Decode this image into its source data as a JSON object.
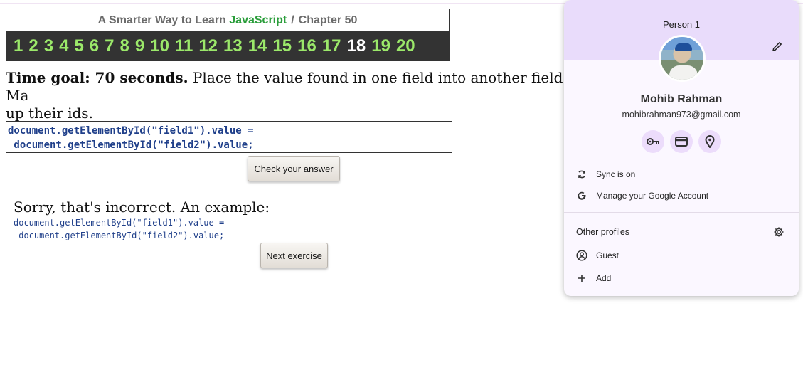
{
  "header": {
    "title_prefix": "A Smarter Way to Learn",
    "title_brand": "JavaScript",
    "separator": "/",
    "chapter": "Chapter 50"
  },
  "exercises": [
    "1",
    "2",
    "3",
    "4",
    "5",
    "6",
    "7",
    "8",
    "9",
    "10",
    "11",
    "12",
    "13",
    "14",
    "15",
    "16",
    "17",
    "18",
    "19",
    "20"
  ],
  "current_exercise": "18",
  "task": {
    "goal": "Time goal: 70 seconds.",
    "text": "Place the value found in one field into another field. Ma",
    "text_line2": "up their ids."
  },
  "answer": {
    "value": "document.getElementById(\"field1\").value =\n document.getElementById(\"field2\").value;"
  },
  "buttons": {
    "check": "Check your answer",
    "next": "Next exercise"
  },
  "feedback": {
    "message": "Sorry, that's incorrect. An example:",
    "code_line1": "document.getElementById(\"field1\").value =",
    "code_line2": " document.getElementById(\"field2\").value;"
  },
  "profile": {
    "person_label": "Person 1",
    "name": "Mohib Rahman",
    "email": "mohibrahman973@gmail.com",
    "quick_actions": [
      "password-key-icon",
      "payment-card-icon",
      "location-pin-icon"
    ],
    "sync": "Sync is on",
    "manage": "Manage your Google Account",
    "other_profiles": "Other profiles",
    "guest": "Guest",
    "add": "Add"
  },
  "colors": {
    "brand_green": "#2a9d3a",
    "exercise_green": "#9be86a",
    "code_blue": "#1f3f8a",
    "popup_header": "#e9dcfb",
    "popup_bg": "#fbf7ff"
  }
}
